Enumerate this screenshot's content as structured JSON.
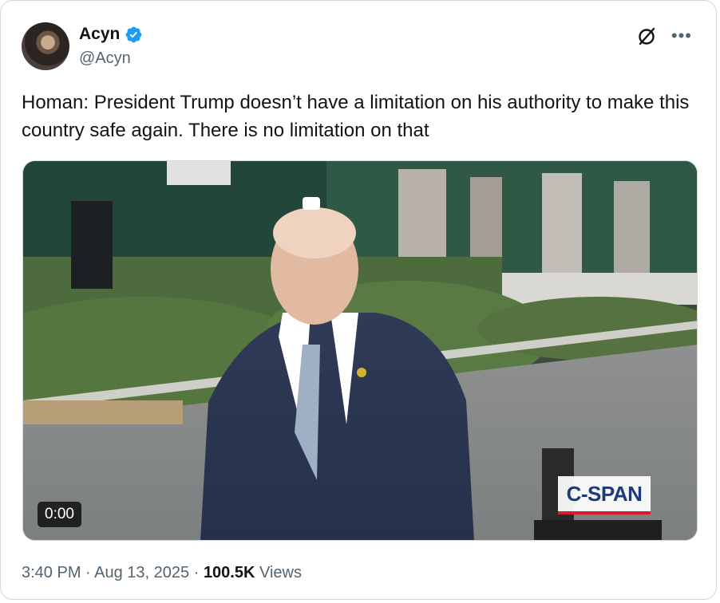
{
  "author": {
    "name": "Acyn",
    "handle": "@Acyn",
    "verified": true,
    "verified_color": "#1d9bf0"
  },
  "tweet": {
    "text": "Homan: President Trump doesn’t have a limitation on his authority to make this country safe again. There is no limitation on that"
  },
  "video": {
    "duration": "0:00",
    "watermark": "C-SPAN"
  },
  "meta": {
    "time": "3:40 PM",
    "sep1": " · ",
    "date": "Aug 13, 2025",
    "sep2": " · ",
    "views_count": "100.5K",
    "views_label": " Views"
  },
  "icons": {
    "grok": "grok-icon",
    "more": "more-icon"
  }
}
